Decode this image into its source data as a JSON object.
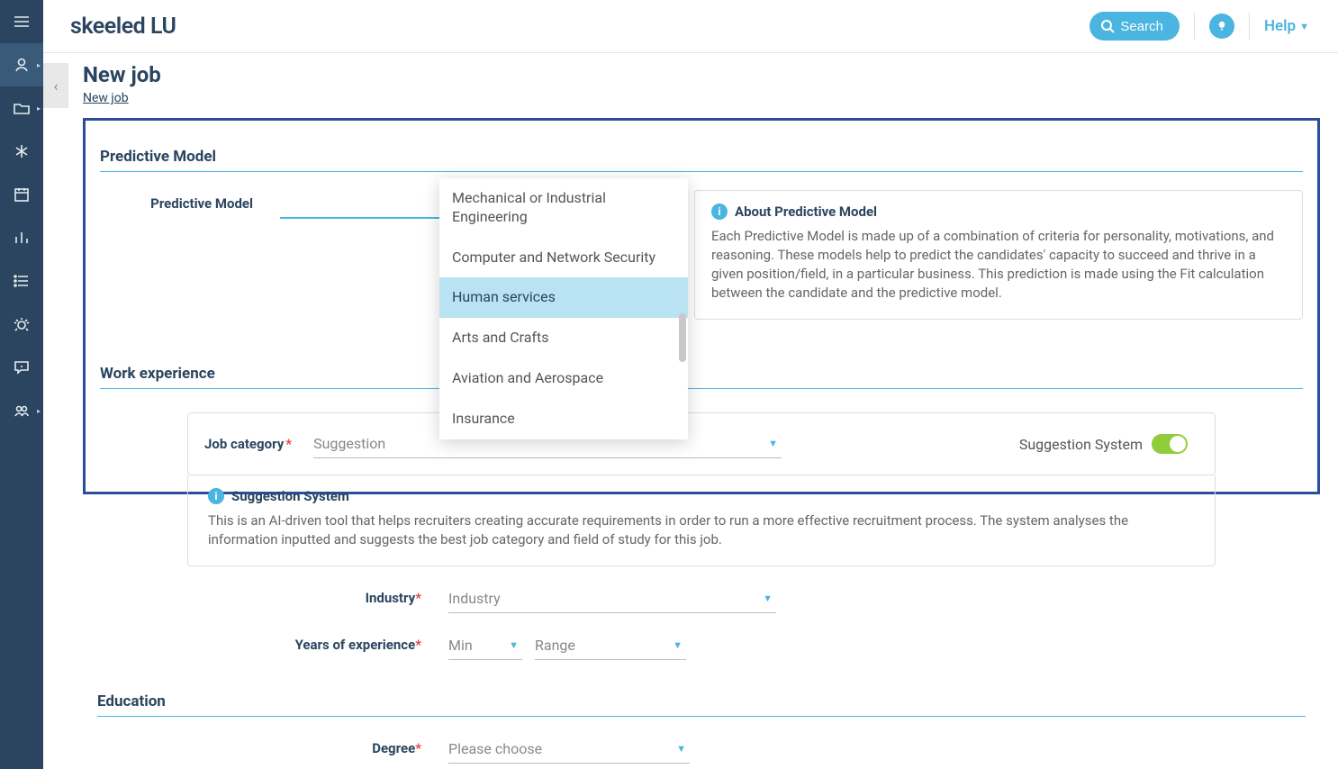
{
  "brand": "skeeled LU",
  "header": {
    "search_label": "Search",
    "help_label": "Help"
  },
  "page": {
    "title": "New job",
    "breadcrumb": "New job"
  },
  "sections": {
    "predictive_model": {
      "heading": "Predictive Model",
      "field_label": "Predictive Model",
      "info_title": "About Predictive Model",
      "info_body": "Each Predictive Model is made up of a combination of criteria for personality, motivations, and reasoning. These models help to predict the candidates' capacity to succeed and thrive in a given position/field, in a particular business. This prediction is made using the Fit calculation between the candidate and the predictive model."
    },
    "work_experience": {
      "heading": "Work experience",
      "job_category_label": "Job category",
      "job_category_placeholder": "Suggestion",
      "suggestion_toggle_label": "Suggestion System",
      "suggestion_box_title": "Suggestion System",
      "suggestion_box_body": "This is an AI-driven tool that helps recruiters creating accurate requirements in order to run a more effective recruitment process. The system analyses the information inputted and suggests the best job category and field of study for this job.",
      "industry_label": "Industry",
      "industry_placeholder": "Industry",
      "yoe_label": "Years of experience",
      "yoe_min_placeholder": "Min",
      "yoe_range_placeholder": "Range"
    },
    "education": {
      "heading": "Education",
      "degree_label": "Degree",
      "degree_placeholder": "Please choose"
    }
  },
  "dropdown": {
    "items": [
      "Mechanical or Industrial Engineering",
      "Computer and Network Security",
      "Human services",
      "Arts and Crafts",
      "Aviation and Aerospace",
      "Insurance"
    ],
    "highlighted_index": 2
  },
  "sidebar_icons": [
    "menu-icon",
    "user-icon",
    "folder-icon",
    "asterisk-icon",
    "calendar-icon",
    "bar-chart-icon",
    "list-icon",
    "bug-icon",
    "comment-icon",
    "group-icon"
  ]
}
